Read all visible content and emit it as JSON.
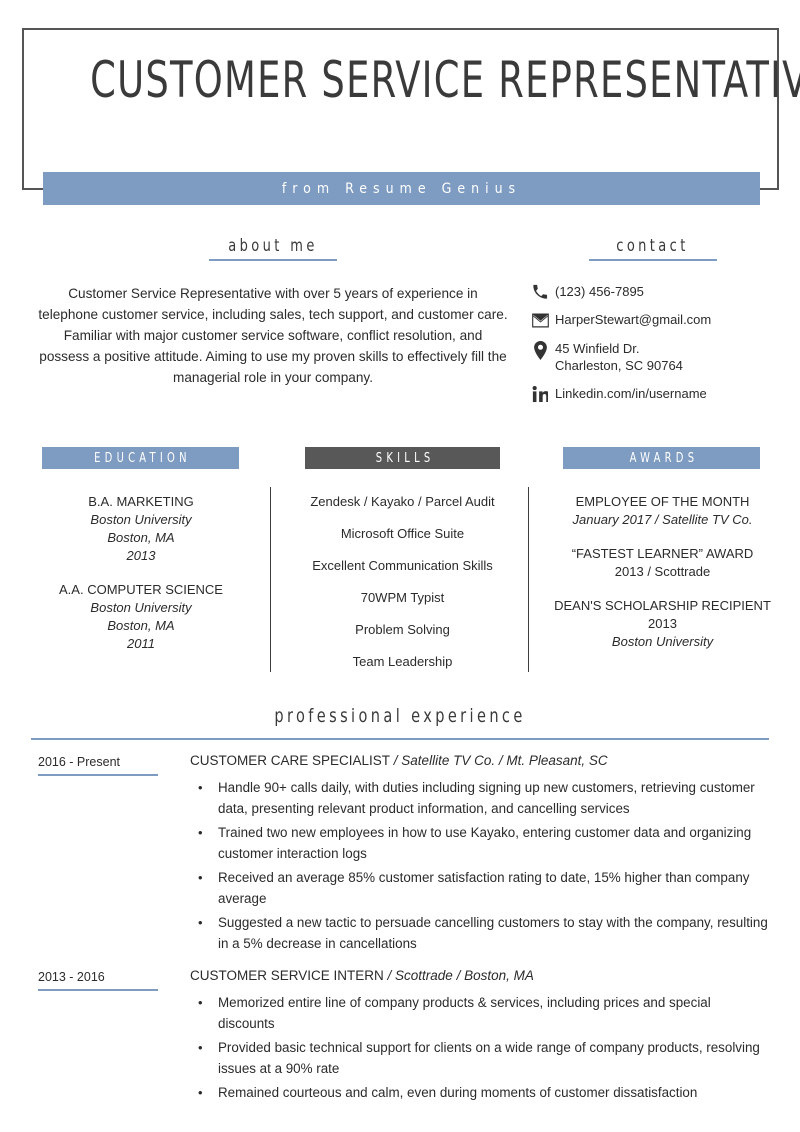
{
  "header": {
    "title": "CUSTOMER SERVICE REPRESENTATIVE",
    "subtitle": "from Resume Genius"
  },
  "about": {
    "heading": "about me",
    "text": "Customer Service Representative with over 5 years of experience in telephone customer service, including sales, tech support, and customer care. Familiar with major customer service software, conflict resolution, and possess a positive attitude. Aiming to use my proven skills to effectively fill the managerial role in your company."
  },
  "contact": {
    "heading": "contact",
    "items": [
      {
        "icon": "phone-icon",
        "value": "(123) 456-7895"
      },
      {
        "icon": "email-icon",
        "value": "HarperStewart@gmail.com"
      },
      {
        "icon": "location-icon",
        "value": "45 Winfield Dr.\nCharleston, SC 90764"
      },
      {
        "icon": "linkedin-icon",
        "value": "Linkedin.com/in/username"
      }
    ]
  },
  "education": {
    "heading": "EDUCATION",
    "entries": [
      {
        "title": "B.A. MARKETING",
        "lines": [
          "Boston University",
          "Boston, MA",
          "2013"
        ]
      },
      {
        "title": "A.A. COMPUTER SCIENCE",
        "lines": [
          "Boston University",
          "Boston, MA",
          "2011"
        ]
      }
    ]
  },
  "skills": {
    "heading": "SKILLS",
    "items": [
      "Zendesk / Kayako / Parcel Audit",
      "Microsoft Office Suite",
      "Excellent Communication Skills",
      "70WPM Typist",
      "Problem Solving",
      "Team Leadership"
    ]
  },
  "awards": {
    "heading": "AWARDS",
    "entries": [
      {
        "title": "EMPLOYEE OF THE MONTH",
        "lines": [
          "January 2017 / Satellite TV Co."
        ],
        "italic": [
          true
        ]
      },
      {
        "title": "“FASTEST LEARNER” AWARD",
        "lines": [
          "2013 / Scottrade"
        ],
        "italic": [
          false
        ]
      },
      {
        "title": "DEAN'S SCHOLARSHIP RECIPIENT",
        "lines": [
          "2013",
          "Boston University"
        ],
        "italic": [
          false,
          true
        ]
      }
    ]
  },
  "experience": {
    "heading": "professional experience",
    "jobs": [
      {
        "date": "2016 - Present",
        "role": "CUSTOMER CARE SPECIALIST",
        "meta": " / Satellite TV Co. /  Mt. Pleasant, SC",
        "bullets": [
          "Handle 90+ calls daily, with duties including signing up new customers, retrieving customer data, presenting relevant product information, and cancelling services",
          "Trained two new employees in how to use Kayako, entering customer data and organizing customer interaction logs",
          "Received an average 85% customer satisfaction rating to date, 15% higher than company average",
          "Suggested a new tactic to persuade cancelling customers to stay with the company, resulting in a 5% decrease in cancellations"
        ]
      },
      {
        "date": "2013 - 2016",
        "role": "CUSTOMER SERVICE INTERN",
        "meta": " / Scottrade / Boston, MA",
        "bullets": [
          "Memorized entire line of company products & services, including prices and special discounts",
          "Provided basic technical support for clients on a wide range of company products, resolving issues at a 90% rate",
          "Remained courteous and calm, even during moments of customer dissatisfaction"
        ]
      }
    ]
  },
  "colors": {
    "accent_blue": "#7e9bc2",
    "dark_gray": "#585858",
    "text": "#2b2b2b",
    "frame_border": "#555555"
  }
}
